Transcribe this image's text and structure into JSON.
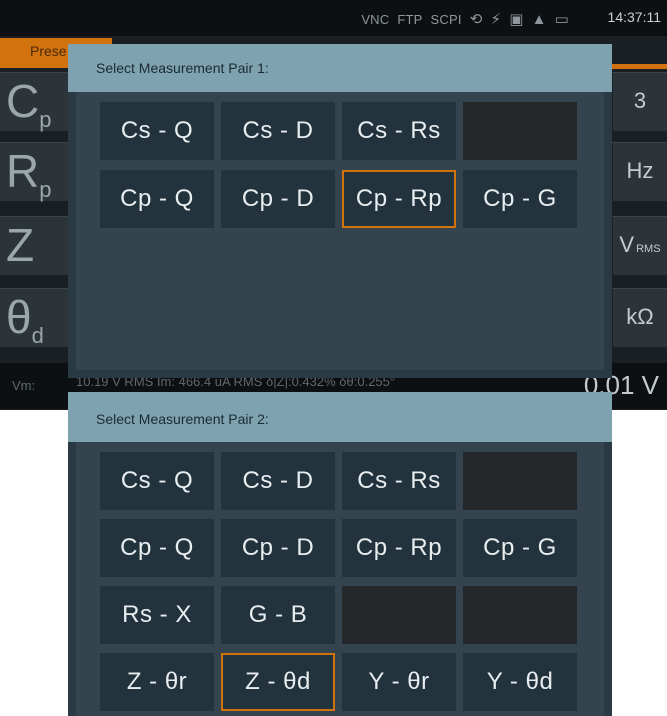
{
  "status_bar": {
    "items": [
      "VNC",
      "FTP",
      "SCPI"
    ],
    "clock": "14:37:11"
  },
  "preset_tab": "Prese",
  "parameters": [
    {
      "symbol": "C",
      "sub": "p",
      "unit": "3"
    },
    {
      "symbol": "R",
      "sub": "p",
      "unit": "Hz"
    },
    {
      "symbol": "Z",
      "sub": "",
      "unit": "V",
      "unit_sub": "RMS"
    },
    {
      "symbol": "θ",
      "sub": "d",
      "unit": "kΩ"
    }
  ],
  "vm_row": {
    "label": "Vm:",
    "info": "10.19 V RMS   Im: 466.4 uA RMS   δ|Z|:0.432%   δθ:0.255°",
    "value": "0.01 V"
  },
  "dialog1": {
    "title": "Select Measurement Pair 1:",
    "buttons": [
      [
        "Cs - Q",
        "Cs - D",
        "Cs - Rs",
        ""
      ],
      [
        "Cp - Q",
        "Cp - D",
        "Cp - Rp",
        "Cp - G"
      ]
    ],
    "selected": "Cp - Rp"
  },
  "dialog2": {
    "title": "Select Measurement Pair 2:",
    "buttons": [
      [
        "Cs - Q",
        "Cs - D",
        "Cs - Rs",
        ""
      ],
      [
        "Cp - Q",
        "Cp - D",
        "Cp - Rp",
        "Cp - G"
      ],
      [
        "Rs - X",
        "G - B",
        "",
        ""
      ],
      [
        "Z - θr",
        "Z - θd",
        "Y - θr",
        "Y - θd"
      ]
    ],
    "selected": "Z - θd"
  },
  "colors": {
    "accent": "#d2720e",
    "dialog_header": "#7fa2b1",
    "button": "#23333d"
  }
}
